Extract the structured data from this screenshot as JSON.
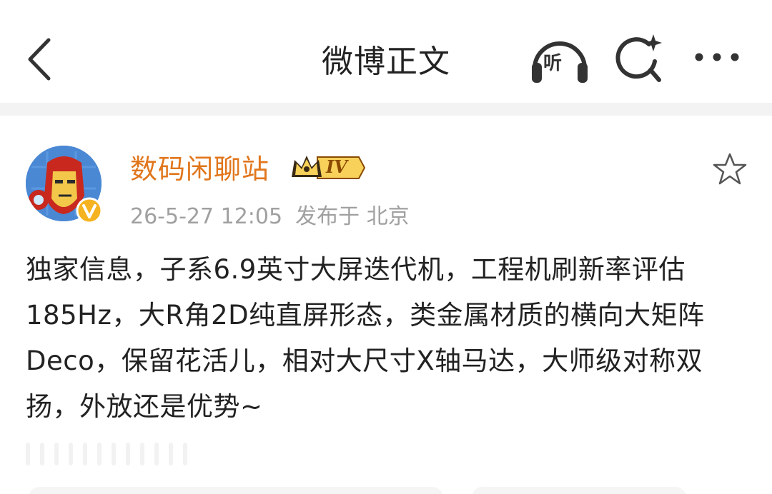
{
  "header": {
    "title": "微博正文",
    "listen_label": "听"
  },
  "post": {
    "author": "数码闲聊站",
    "level": "IV",
    "time": "26-5-27 12:05",
    "location": "发布于 北京",
    "text": "独家信息，子系6.9英寸大屏迭代机，工程机刷新率评估185Hz，大R角2D纯直屏形态，类金属材质的横向大矩阵Deco，保留花活儿，相对大尺寸X轴马达，大师级对称双扬，外放还是优势~"
  },
  "colors": {
    "username": "#e1761c",
    "meta": "#a0a0a0",
    "text": "#222222",
    "divider": "#f3f3f3"
  },
  "icons": {
    "back": "chevron-left-icon",
    "listen": "headphones-icon",
    "search": "sparkle-search-icon",
    "more": "more-dots-icon",
    "favorite": "star-outline-icon",
    "verified": "verified-v-icon",
    "crown": "crown-icon"
  }
}
